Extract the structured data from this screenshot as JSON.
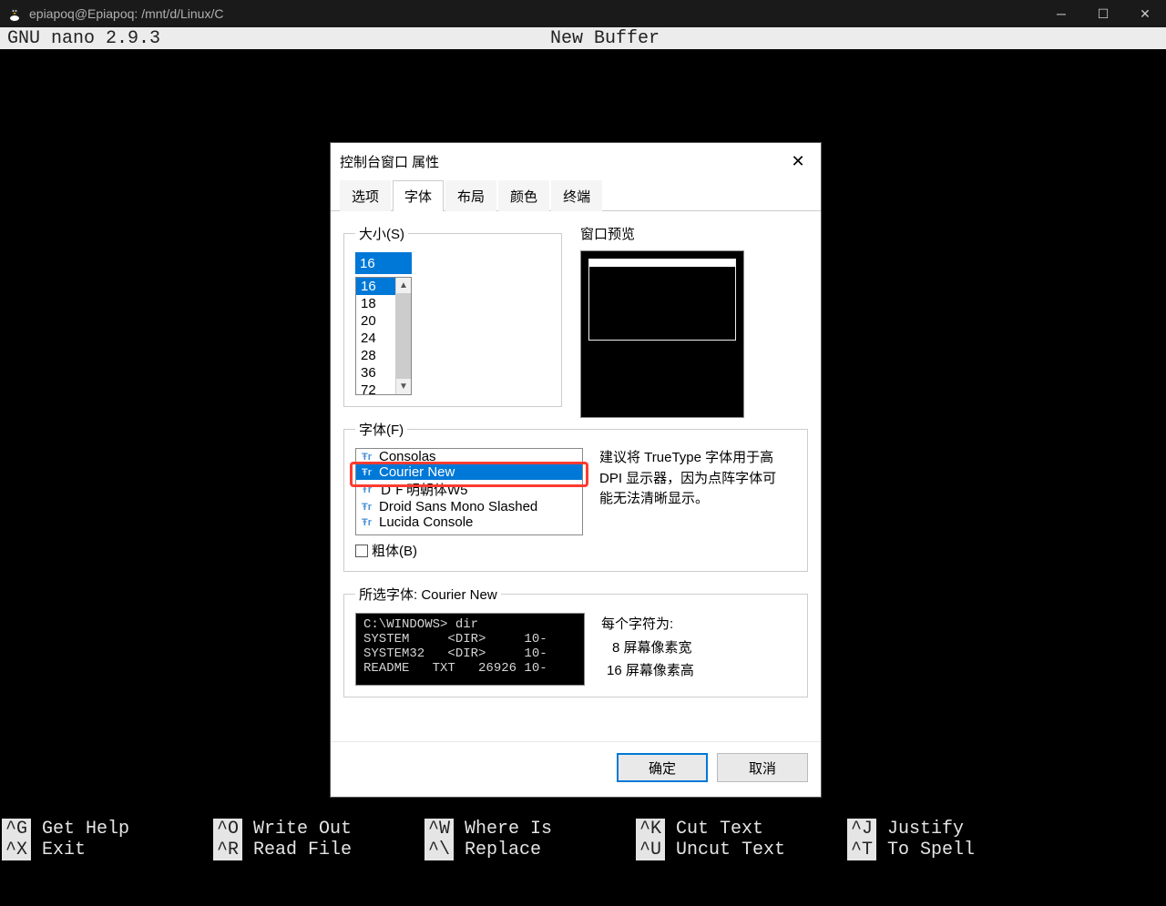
{
  "titlebar": {
    "text": "epiapoq@Epiapoq: /mnt/d/Linux/C"
  },
  "nano": {
    "app": "  GNU nano 2.9.3",
    "buffer": "New Buffer",
    "shortcuts": [
      [
        {
          "k": "^G",
          "l": "Get Help"
        },
        {
          "k": "^O",
          "l": "Write Out"
        },
        {
          "k": "^W",
          "l": "Where Is"
        },
        {
          "k": "^K",
          "l": "Cut Text"
        },
        {
          "k": "^J",
          "l": "Justify"
        }
      ],
      [
        {
          "k": "^X",
          "l": "Exit"
        },
        {
          "k": "^R",
          "l": "Read File"
        },
        {
          "k": "^\\",
          "l": "Replace"
        },
        {
          "k": "^U",
          "l": "Uncut Text"
        },
        {
          "k": "^T",
          "l": "To Spell"
        }
      ]
    ]
  },
  "dialog": {
    "title": "控制台窗口 属性",
    "tabs": [
      "选项",
      "字体",
      "布局",
      "颜色",
      "终端"
    ],
    "active_tab": 1,
    "size_label": "大小(S)",
    "size_value": "16",
    "size_list": [
      "16",
      "18",
      "20",
      "24",
      "28",
      "36",
      "72"
    ],
    "preview_label": "窗口预览",
    "font_label": "字体(F)",
    "fonts": [
      "Consolas",
      "Courier New",
      "ＤＦ明朝体W5",
      "Droid Sans Mono Slashed",
      "Lucida Console"
    ],
    "font_selected_index": 1,
    "note1": "建议将 TrueType 字体用于高 DPI 显示器，因为点阵字体可能无法清晰显示。",
    "bold_label": "粗体(B)",
    "selected_font_label": "所选字体: Courier New",
    "sample_text": "C:\\WINDOWS> dir\nSYSTEM     <DIR>     10-\nSYSTEM32   <DIR>     10-\nREADME   TXT   26926 10-",
    "metrics_title": "每个字符为:",
    "metrics_w": "8 屏幕像素宽",
    "metrics_h": "16 屏幕像素高",
    "ok": "确定",
    "cancel": "取消"
  }
}
